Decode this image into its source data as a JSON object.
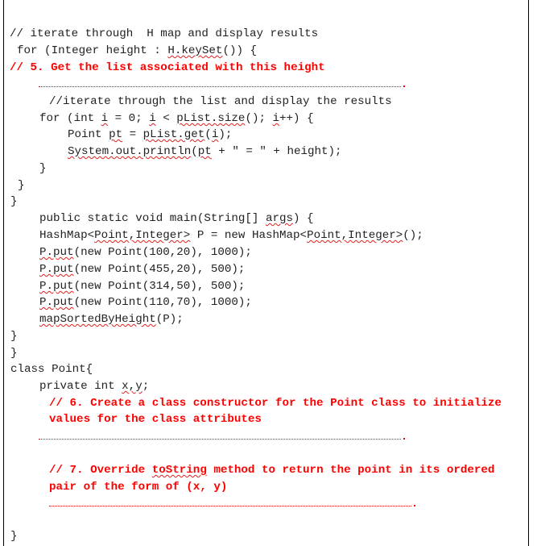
{
  "colors": {
    "code": "#222222",
    "comment_red": "#ff0000",
    "spellcheck": "#e02020"
  },
  "code": {
    "l1": "// iterate through  H map and display results",
    "l2_pre": "for (Integer height : ",
    "l2_sq": "H.keySet",
    "l2_post": "()) {",
    "l3": "// 5. Get the list associated with this height",
    "l5": "//iterate through the list and display the results",
    "l6_a": "for (int ",
    "l6_b": "i",
    "l6_c": " = 0; ",
    "l6_d": "i",
    "l6_e": " < ",
    "l6_f": "pList.size",
    "l6_g": "(); ",
    "l6_h": "i",
    "l6_i": "++) {",
    "l7_a": "Point ",
    "l7_b": "pt",
    "l7_c": " = ",
    "l7_d": "pList.get",
    "l7_e": "(",
    "l7_f": "i",
    "l7_g": ");",
    "l8_a": "System.out.println",
    "l8_b": "(",
    "l8_c": "pt",
    "l8_d": " + \" = \" + height);",
    "l9": "}",
    "l10": "}",
    "l11": "}",
    "l12_a": "public static void main(String[] ",
    "l12_b": "args",
    "l12_c": ") {",
    "l13_a": "HashMap<",
    "l13_b": "Point,Integer>",
    "l13_c": " P = new HashMap<",
    "l13_d": "Point,Integer>",
    "l13_e": "();",
    "l14_a": "P.put",
    "l14_b": "(new Point(100,20), 1000);",
    "l15_a": "P.put",
    "l15_b": "(new Point(455,20), 500);",
    "l16_a": "P.put",
    "l16_b": "(new Point(314,50), 500);",
    "l17_a": "P.put",
    "l17_b": "(new Point(110,70), 1000);",
    "l18_a": "mapSortedByHeight",
    "l18_b": "(P);",
    "l19": "}",
    "l20": "}",
    "l21": "class Point{",
    "l22_a": "private int ",
    "l22_b": "x,y",
    "l22_c": ";",
    "l23": "// 6. Create a class constructor for the Point class to initialize",
    "l24": "values for the class attributes",
    "l26_a": "// 7. Override ",
    "l26_b": "toString",
    "l26_c": " method to return the point in its ordered",
    "l27": "pair of the form of (x, y)",
    "l29": "}"
  }
}
